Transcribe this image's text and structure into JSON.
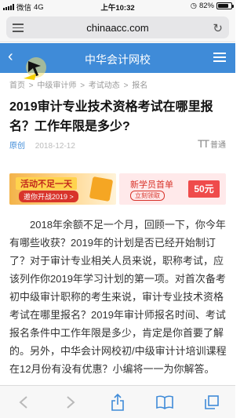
{
  "status_bar": {
    "carrier": "微信",
    "network": "4G",
    "time": "上午10:32",
    "battery": "82%",
    "battery_level": 0.82
  },
  "browser": {
    "url": "chinaacc.com"
  },
  "site_header": {
    "title": "中华会计网校"
  },
  "breadcrumb": {
    "items": [
      "首页",
      "中级审计师",
      "考试动态",
      "报名"
    ],
    "separator": ">"
  },
  "article": {
    "title": "2019审计专业技术资格考试在哪里报名？工作年限是多少?",
    "tag": "原创",
    "date": "2018-12-12",
    "font_size_label": "普通",
    "font_size_glyph": "TT",
    "body": "2018年余额不足一个月，回顾一下，你今年有哪些收获？2019年的计划是否已经开始制订了？对于审计专业相关人员来说，职称考试，应该列作你2019年学习计划的第一项。对首次备考初中级审计职称的考生来说，审计专业技术资格考试在哪里报名？2019年审计师报名时间、考试报名条件中工作年限是多少，肯定是你首要了解的。另外，中华会计网校初/中级审计计培训课程在12月份有没有优惠？小编将一一为你解答。"
  },
  "banners": {
    "left": {
      "headline": "活动不足一天",
      "sub": "邀你开战2019 >"
    },
    "right": {
      "headline": "新学员首单",
      "sub": "立刻领取",
      "amount": "50元"
    }
  },
  "toolbar": {
    "icons": [
      "back-icon",
      "forward-icon",
      "share-icon",
      "bookmarks-icon",
      "tabs-icon"
    ]
  },
  "colors": {
    "header": "#3f8bd8",
    "accent_red": "#d8342b"
  }
}
